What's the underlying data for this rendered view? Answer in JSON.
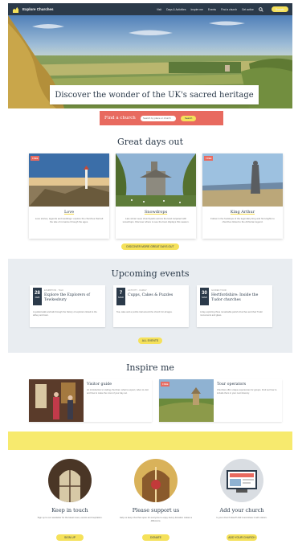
{
  "header": {
    "site_name": "Explore Churches",
    "nav": [
      "Visit",
      "Days & Activities",
      "Inspire me",
      "Events",
      "Find a church",
      "Get active"
    ],
    "donate_label": "Donate"
  },
  "hero": {
    "caption": "Discover the wonder of the UK's sacred heritage"
  },
  "find": {
    "label": "Find a church",
    "placeholder": "Search by place or church",
    "button": "Search"
  },
  "great_days": {
    "title": "Great days out",
    "cards": [
      {
        "tag": "FREE",
        "title": "Love",
        "desc": "Love stories, legends and weddings: explore the churches that tell the tale of romance through the ages."
      },
      {
        "title": "Snowdrops",
        "desc": "Late winter sees churchyards across the land carpeted with snowdrops. Discover where to see the best displays this season."
      },
      {
        "tag": "FREE",
        "title": "King Arthur",
        "desc": "Follow in the footsteps of the legendary king and his knights to churches linked to the Arthurian legend."
      }
    ],
    "button": "DISCOVER MORE GREAT DAYS OUT"
  },
  "events": {
    "title": "Upcoming events",
    "items": [
      {
        "day": "28",
        "month": "FEB",
        "meta": "EXHIBITION · TALK",
        "title": "Explore the Explorers of Tewkesbury",
        "desc": "A guided walk and talk through the history of explorers linked to the abbey and town."
      },
      {
        "day": "7",
        "month": "MAR",
        "meta": "ACTIVITY · FAMILY",
        "title": "Cupps, Cakes & Puzzles",
        "desc": "Tea, cake and a puzzle trail around the church for all ages."
      },
      {
        "day": "30",
        "month": "MAR",
        "meta": "GUIDED TOUR",
        "title": "Hertfordshire: Inside the Tudor churches",
        "desc": "A day exploring three remarkable parish churches and their Tudor monuments and glass."
      }
    ],
    "button": "ALL EVENTS"
  },
  "inspire": {
    "title": "Inspire me",
    "items": [
      {
        "title": "Visitor guide",
        "desc": "An introduction to visiting churches: what to expect, when to visit and how to make the most of your day out."
      },
      {
        "tag": "FREE",
        "title": "Tour operators",
        "desc": "Churches offer unique experiences for groups. Find out how to include them in your next itinerary."
      }
    ]
  },
  "bottom": [
    {
      "title": "Keep in touch",
      "desc": "Sign up to our newsletter for the latest news, events and inspiration.",
      "button": "SIGN UP"
    },
    {
      "title": "Please support us",
      "desc": "Help us keep churches open for everyone to enjoy. Every donation makes a difference.",
      "button": "DONATE"
    },
    {
      "title": "Add your church",
      "desc": "Is your church listed? Add it and share it with visitors.",
      "button": "ADD YOUR CHURCH"
    }
  ],
  "colors": {
    "navy": "#2b3a4a",
    "coral": "#e86a5f",
    "yellow": "#f5e15a"
  }
}
